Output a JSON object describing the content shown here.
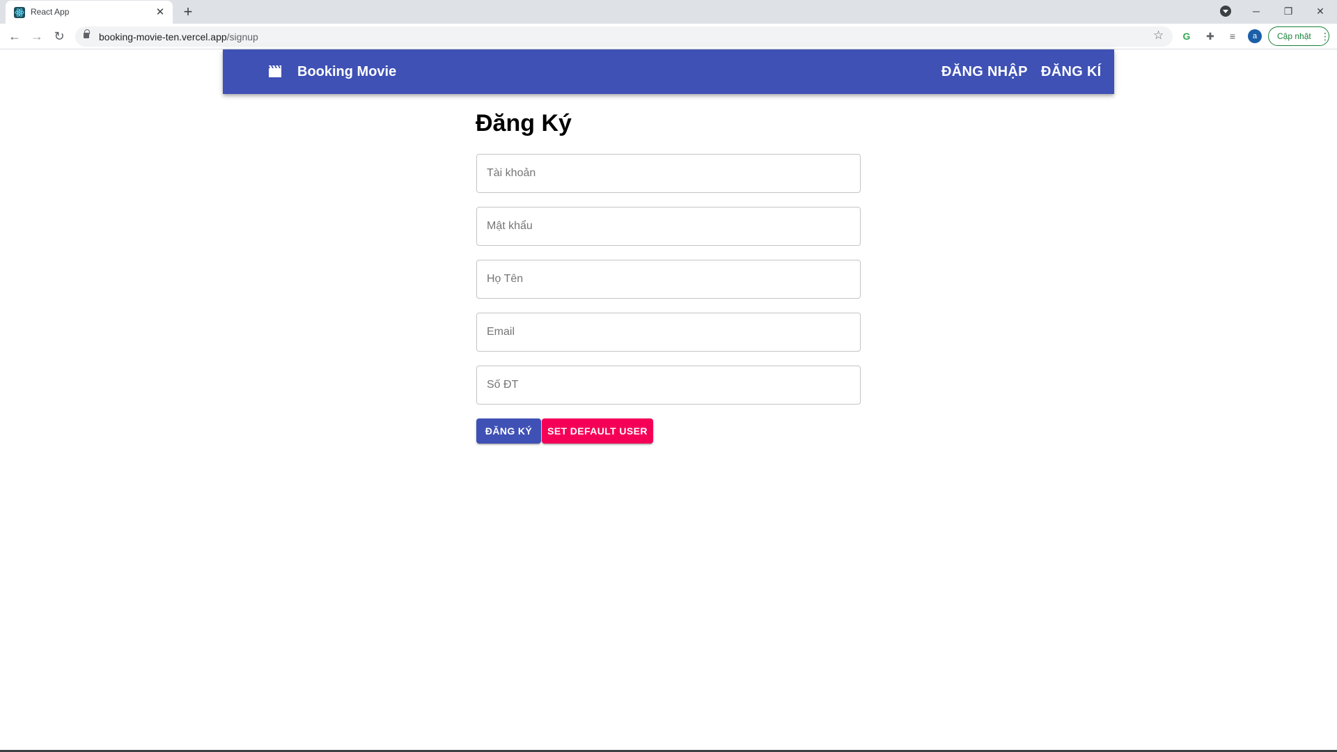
{
  "browser": {
    "tab_title": "React App",
    "url_host": "booking-movie-ten.vercel.app",
    "url_path": "/signup",
    "update_label": "Cập nhật",
    "avatar_letter": "a"
  },
  "navbar": {
    "brand": "Booking Movie",
    "brand_icon": "movie-clapperboard-icon",
    "links": [
      {
        "label": "ĐĂNG NHẬP"
      },
      {
        "label": "ĐĂNG KÍ"
      }
    ],
    "color": "#3f51b5"
  },
  "form": {
    "title": "Đăng Ký",
    "fields": [
      {
        "placeholder": "Tài khoản",
        "value": ""
      },
      {
        "placeholder": "Mật khẩu",
        "value": ""
      },
      {
        "placeholder": "Họ Tên",
        "value": ""
      },
      {
        "placeholder": "Email",
        "value": ""
      },
      {
        "placeholder": "Số ĐT",
        "value": ""
      }
    ],
    "submit_label": "ĐĂNG KÝ",
    "default_user_label": "SET DEFAULT USER",
    "primary_color": "#3f51b5",
    "secondary_color": "#f50057"
  }
}
